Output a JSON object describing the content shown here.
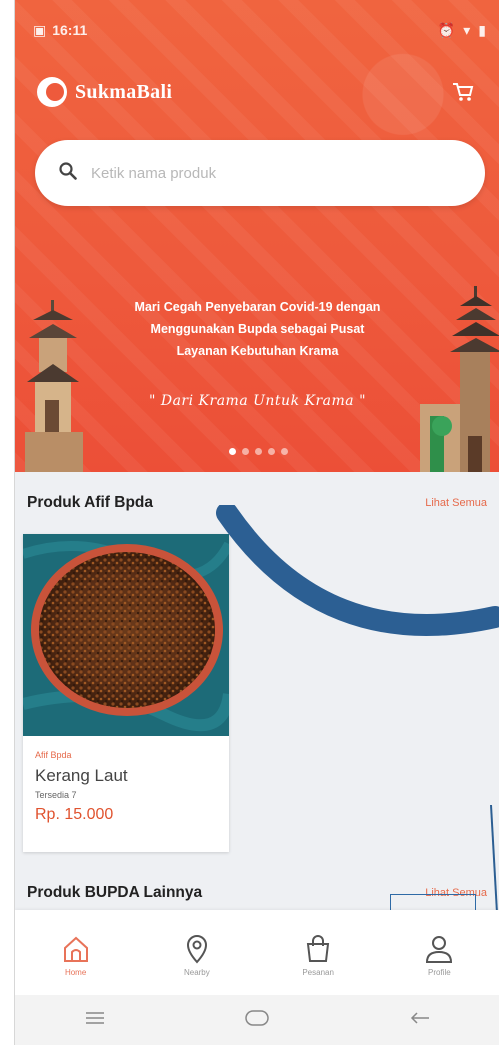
{
  "status_bar": {
    "time": "16:11"
  },
  "app": {
    "brand_name": "SukmaBali"
  },
  "search": {
    "placeholder": "Ketik nama produk"
  },
  "banner": {
    "line1": "Mari Cegah Penyebaran Covid-19 dengan",
    "line2": "Menggunakan Bupda sebagai Pusat",
    "line3": "Layanan Kebutuhan Krama",
    "slogan": "\" Dari Krama Untuk Krama \"",
    "active_slide": 0,
    "slide_count": 5
  },
  "section_afif": {
    "title": "Produk Afif Bpda",
    "see_all": "Lihat Semua"
  },
  "product": {
    "seller": "Afif Bpda",
    "name": "Kerang Laut",
    "stock": "Tersedia 7",
    "price": "Rp. 15.000"
  },
  "section_bupda": {
    "title": "Produk BUPDA Lainnya",
    "see_all": "Lihat Semua"
  },
  "bottom_nav": {
    "items": [
      {
        "label": "Home",
        "icon": "home-icon"
      },
      {
        "label": "Nearby",
        "icon": "location-pin-icon"
      },
      {
        "label": "Pesanan",
        "icon": "shopping-bag-icon"
      },
      {
        "label": "Profile",
        "icon": "user-icon"
      }
    ],
    "active_index": 0
  },
  "colors": {
    "brand": "#ee5a3c",
    "accent": "#e66a4b",
    "annotation": "#2e6aa6"
  }
}
